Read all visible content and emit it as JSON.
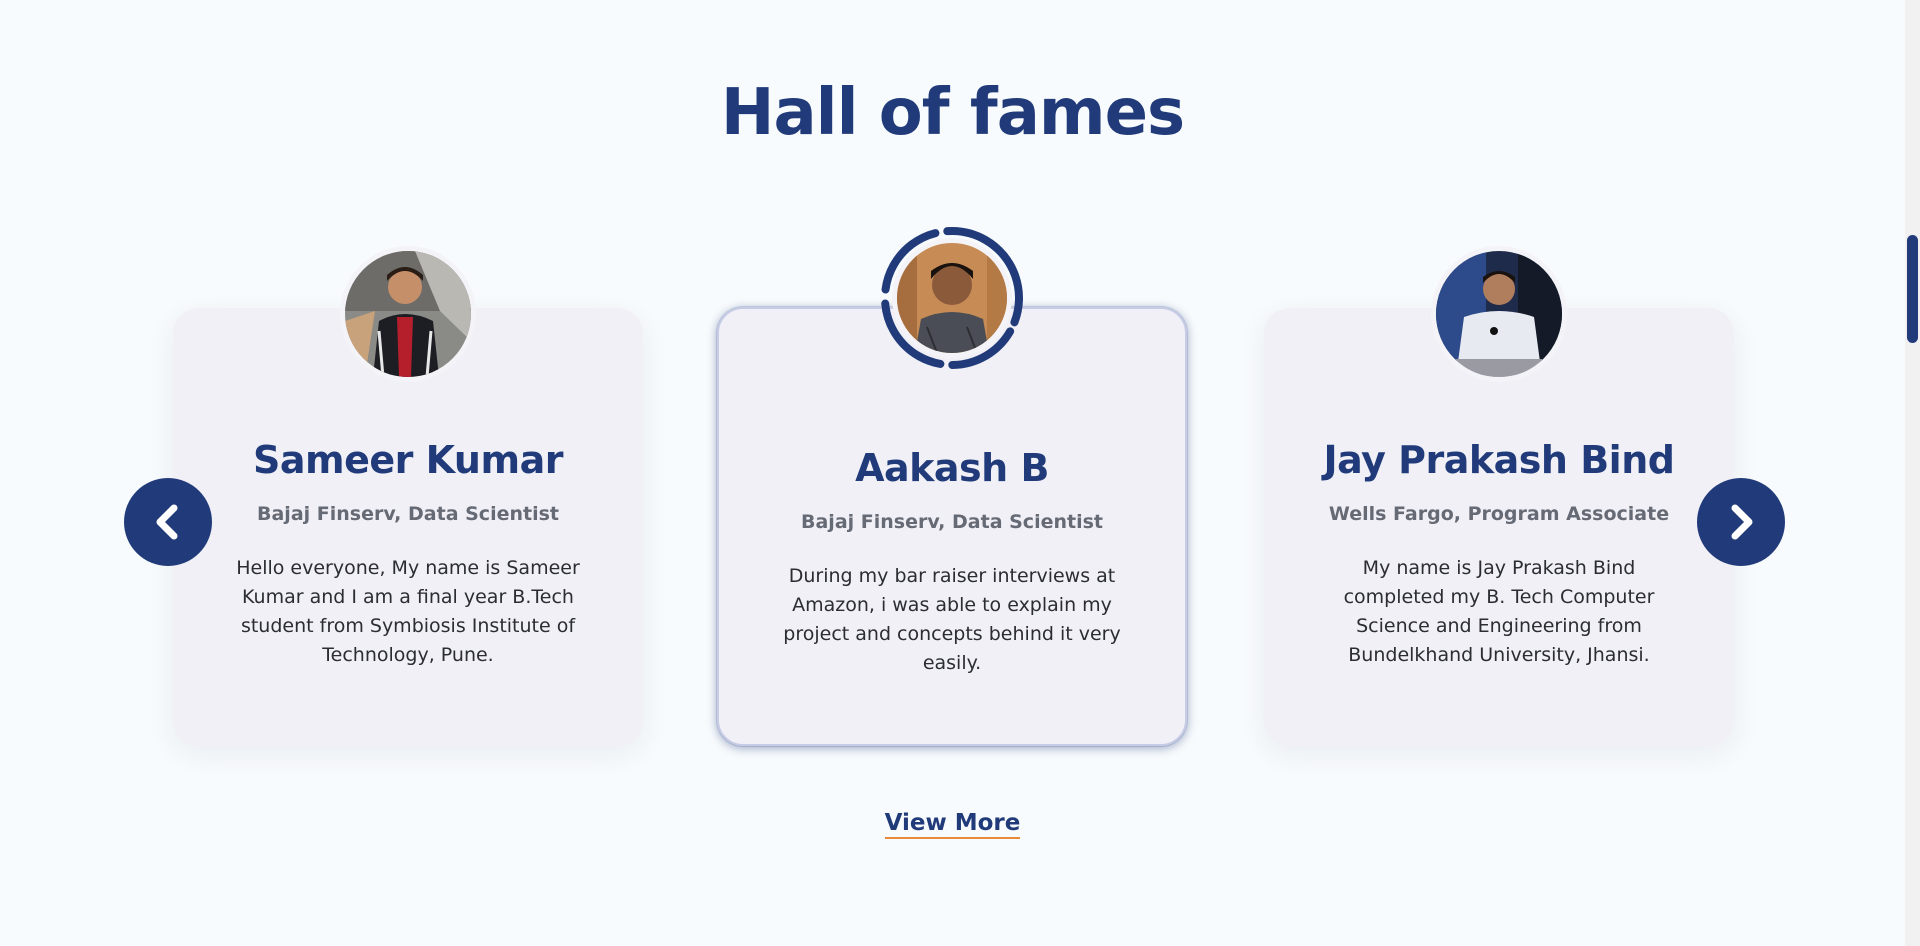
{
  "section": {
    "title": "Hall of fames",
    "view_more_label": "View More"
  },
  "cards": [
    {
      "name": "Sameer Kumar",
      "role": "Bajaj Finserv, Data Scientist",
      "quote": "Hello everyone, My name is Sameer Kumar and I am a final year B.Tech student from Symbiosis Institute of Technology, Pune."
    },
    {
      "name": "Aakash B",
      "role": "Bajaj Finserv, Data Scientist",
      "quote": "During my bar raiser interviews at Amazon, i was able to explain my project and concepts behind it very easily."
    },
    {
      "name": "Jay Prakash Bind",
      "role": "Wells Fargo, Program Associate",
      "quote": "My name is Jay Prakash Bind completed my B. Tech Computer Science and Engineering from Bundelkhand University, Jhansi."
    }
  ],
  "icons": {
    "prev": "chevron-left-icon",
    "next": "chevron-right-icon"
  },
  "colors": {
    "brand_blue": "#213b7a",
    "accent_orange": "#e98a3a",
    "card_bg": "#f0f0f6"
  }
}
